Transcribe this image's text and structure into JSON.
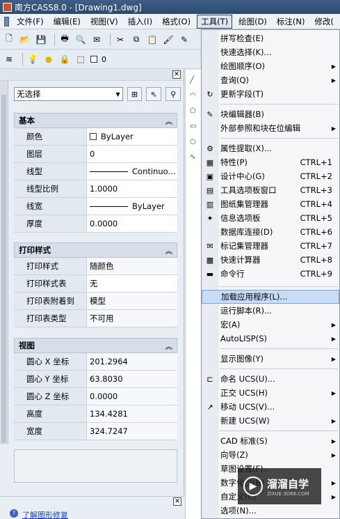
{
  "window": {
    "title": "南方CASS8.0 - [Drawing1.dwg]"
  },
  "menubar": {
    "items": [
      "文件(F)",
      "编辑(E)",
      "视图(V)",
      "插入(I)",
      "格式(O)",
      "工具(T)",
      "绘图(D)",
      "标注(N)",
      "修改("
    ],
    "active_index": 5
  },
  "toolbar": {
    "layer_value": "0"
  },
  "properties": {
    "selector": "无选择",
    "sections": {
      "general": {
        "title": "基本",
        "rows": [
          {
            "name": "颜色",
            "value": "ByLayer"
          },
          {
            "name": "图层",
            "value": "0"
          },
          {
            "name": "线型",
            "value": "Continuo..."
          },
          {
            "name": "线型比例",
            "value": "1.0000"
          },
          {
            "name": "线宽",
            "value": "ByLayer"
          },
          {
            "name": "厚度",
            "value": "0.0000"
          }
        ]
      },
      "plot": {
        "title": "打印样式",
        "rows": [
          {
            "name": "打印样式",
            "value": "随颜色"
          },
          {
            "name": "打印样式表",
            "value": "无"
          },
          {
            "name": "打印表附着到",
            "value": "模型"
          },
          {
            "name": "打印表类型",
            "value": "不可用"
          }
        ]
      },
      "view": {
        "title": "视图",
        "rows": [
          {
            "name": "圆心 X 坐标",
            "value": "201.2964"
          },
          {
            "name": "圆心 Y 坐标",
            "value": "63.8030"
          },
          {
            "name": "圆心 Z 坐标",
            "value": "0.0000"
          },
          {
            "name": "高度",
            "value": "134.4281"
          },
          {
            "name": "宽度",
            "value": "324.7247"
          }
        ]
      }
    }
  },
  "bottom": {
    "link": "了解图形修复"
  },
  "tools_menu": {
    "items": [
      {
        "label": "拼写检查(E)",
        "shortcut": "",
        "sub": false,
        "icon": ""
      },
      {
        "label": "快速选择(K)...",
        "shortcut": "",
        "sub": false,
        "icon": ""
      },
      {
        "label": "绘图顺序(O)",
        "shortcut": "",
        "sub": true,
        "icon": ""
      },
      {
        "label": "查询(Q)",
        "shortcut": "",
        "sub": true,
        "icon": ""
      },
      {
        "label": "更新字段(T)",
        "shortcut": "",
        "sub": false,
        "icon": "update-field"
      },
      {
        "label": "块编辑器(B)",
        "shortcut": "",
        "sub": false,
        "icon": "block-editor"
      },
      {
        "label": "外部参照和块在位编辑",
        "shortcut": "",
        "sub": true,
        "icon": ""
      },
      {
        "label": "属性提取(X)...",
        "shortcut": "",
        "sub": false,
        "icon": "attribute-extract"
      },
      {
        "label": "特性(P)",
        "shortcut": "CTRL+1",
        "sub": false,
        "icon": "properties"
      },
      {
        "label": "设计中心(G)",
        "shortcut": "CTRL+2",
        "sub": false,
        "icon": "design-center"
      },
      {
        "label": "工具选项板窗口",
        "shortcut": "CTRL+3",
        "sub": false,
        "icon": "tool-palette"
      },
      {
        "label": "图纸集管理器",
        "shortcut": "CTRL+4",
        "sub": false,
        "icon": "sheet-set"
      },
      {
        "label": "信息选项板",
        "shortcut": "CTRL+5",
        "sub": false,
        "icon": "info-palette"
      },
      {
        "label": "数据库连接(D)",
        "shortcut": "CTRL+6",
        "sub": false,
        "icon": ""
      },
      {
        "label": "标记集管理器",
        "shortcut": "CTRL+7",
        "sub": false,
        "icon": "markup-set"
      },
      {
        "label": "快速计算器",
        "shortcut": "CTRL+8",
        "sub": false,
        "icon": "calculator"
      },
      {
        "label": "命令行",
        "shortcut": "CTRL+9",
        "sub": false,
        "icon": "command-line"
      },
      {
        "label": "加载应用程序(L)...",
        "shortcut": "",
        "sub": false,
        "icon": "",
        "highlighted": true
      },
      {
        "label": "运行脚本(R)...",
        "shortcut": "",
        "sub": false,
        "icon": ""
      },
      {
        "label": "宏(A)",
        "shortcut": "",
        "sub": true,
        "icon": ""
      },
      {
        "label": "AutoLISP(S)",
        "shortcut": "",
        "sub": true,
        "icon": ""
      },
      {
        "label": "显示图像(Y)",
        "shortcut": "",
        "sub": true,
        "icon": ""
      },
      {
        "label": "命名 UCS(U)...",
        "shortcut": "",
        "sub": false,
        "icon": "named-ucs"
      },
      {
        "label": "正交 UCS(H)",
        "shortcut": "",
        "sub": true,
        "icon": ""
      },
      {
        "label": "移动 UCS(V)...",
        "shortcut": "",
        "sub": false,
        "icon": "move-ucs"
      },
      {
        "label": "新建 UCS(W)",
        "shortcut": "",
        "sub": true,
        "icon": ""
      },
      {
        "label": "CAD 标准(S)",
        "shortcut": "",
        "sub": true,
        "icon": ""
      },
      {
        "label": "向导(Z)",
        "shortcut": "",
        "sub": true,
        "icon": ""
      },
      {
        "label": "草图设置(F)...",
        "shortcut": "",
        "sub": false,
        "icon": ""
      },
      {
        "label": "数字化仪(B)",
        "shortcut": "",
        "sub": true,
        "icon": ""
      },
      {
        "label": "自定义(C)",
        "shortcut": "",
        "sub": true,
        "icon": ""
      },
      {
        "label": "选项(N)...",
        "shortcut": "",
        "sub": false,
        "icon": ""
      }
    ]
  },
  "watermark": {
    "title": "溜溜自学",
    "url": "ZIXUE.3D66.COM"
  }
}
